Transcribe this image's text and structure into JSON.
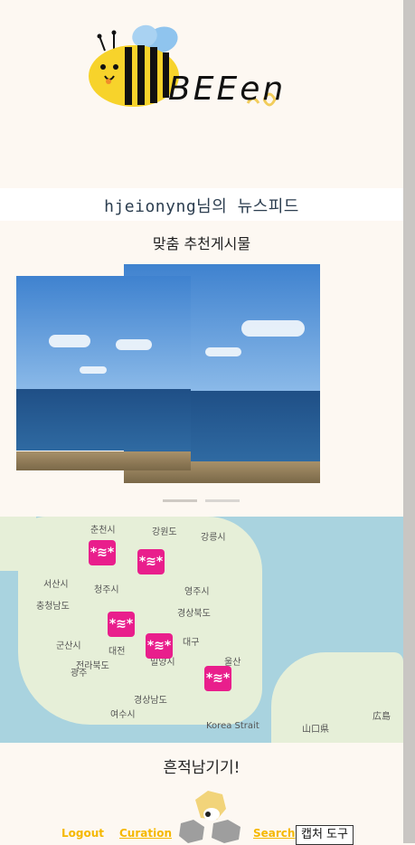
{
  "brand": {
    "logo_text": "BEEen"
  },
  "feed": {
    "title": "hjeionyng님의 뉴스피드",
    "recommended_title": "맞춤 추천게시물"
  },
  "carousel": {
    "slide_count": 2,
    "active_index": 0
  },
  "map": {
    "labels": [
      "춘천시",
      "강원도",
      "강릉시",
      "서산시",
      "청주시",
      "충청남도",
      "영주시",
      "경상북도",
      "군산시",
      "대전",
      "대구",
      "전라북도",
      "밀양시",
      "울산",
      "광주",
      "경상남도",
      "여수시",
      "Korea Strait",
      "山口県",
      "広島"
    ]
  },
  "leave_trace": "흔적남기기!",
  "nav": {
    "logout": "Logout",
    "curation": "Curation",
    "search": "Search"
  },
  "overlay": {
    "capture_tool": "캡처 도구"
  },
  "colors": {
    "background": "#fdf8f2",
    "marker": "#e91e8c",
    "nav": "#f5b800"
  }
}
